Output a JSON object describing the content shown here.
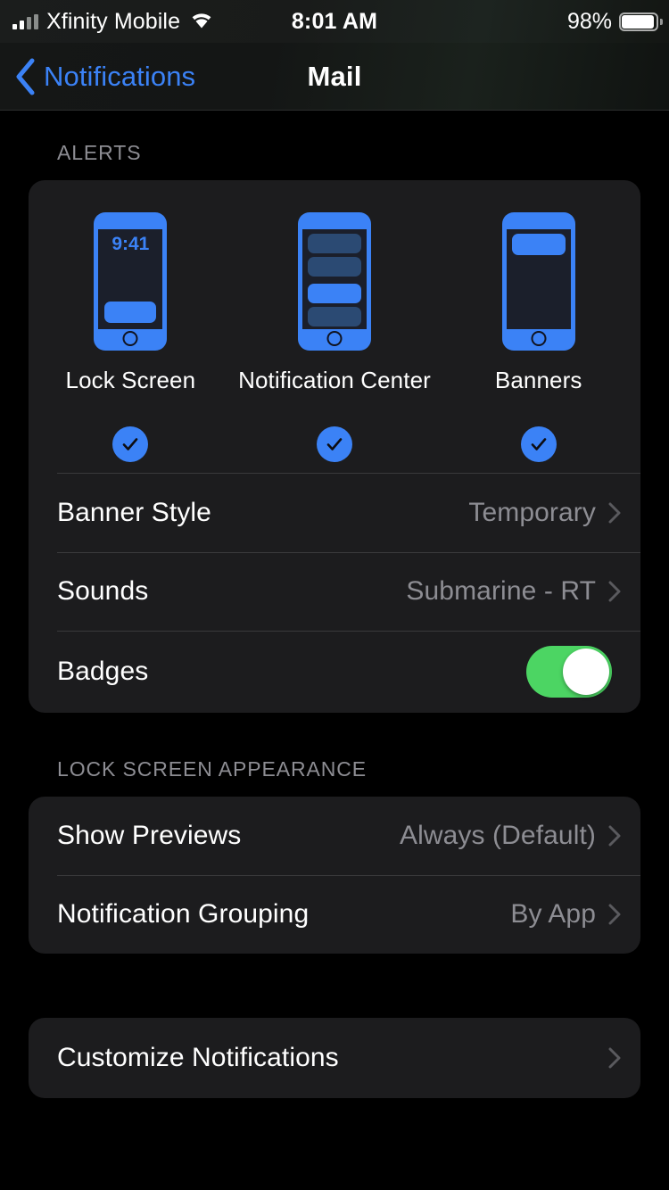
{
  "status_bar": {
    "carrier": "Xfinity Mobile",
    "time": "8:01 AM",
    "battery_percent": "98%",
    "signal_bars_filled": 2,
    "signal_bars_total": 4,
    "wifi_icon": "wifi-icon",
    "battery_icon": "battery-icon"
  },
  "nav": {
    "back_label": "Notifications",
    "back_icon": "chevron-left-icon",
    "title": "Mail"
  },
  "alerts": {
    "header": "ALERTS",
    "options": [
      {
        "label": "Lock Screen",
        "icon": "phone-lock-screen-icon",
        "selected": true,
        "clock": "9:41"
      },
      {
        "label": "Notification Center",
        "icon": "phone-notification-center-icon",
        "selected": true
      },
      {
        "label": "Banners",
        "icon": "phone-banner-icon",
        "selected": true
      }
    ],
    "check_icon": "checkmark-icon",
    "rows": [
      {
        "label": "Banner Style",
        "value": "Temporary",
        "accessory": "chevron-right-icon"
      },
      {
        "label": "Sounds",
        "value": "Submarine - RT",
        "accessory": "chevron-right-icon"
      },
      {
        "label": "Badges",
        "value": "",
        "accessory": "toggle-on"
      }
    ]
  },
  "lock_screen_appearance": {
    "header": "LOCK SCREEN APPEARANCE",
    "rows": [
      {
        "label": "Show Previews",
        "value": "Always (Default)",
        "accessory": "chevron-right-icon"
      },
      {
        "label": "Notification Grouping",
        "value": "By App",
        "accessory": "chevron-right-icon"
      }
    ]
  },
  "customize": {
    "rows": [
      {
        "label": "Customize Notifications",
        "value": "",
        "accessory": "chevron-right-icon"
      }
    ]
  },
  "colors": {
    "accent_blue": "#3b82f6",
    "toggle_green": "#4cd563",
    "card_bg": "#1c1c1e",
    "page_bg": "#000000",
    "secondary_text": "#8d8d93"
  }
}
